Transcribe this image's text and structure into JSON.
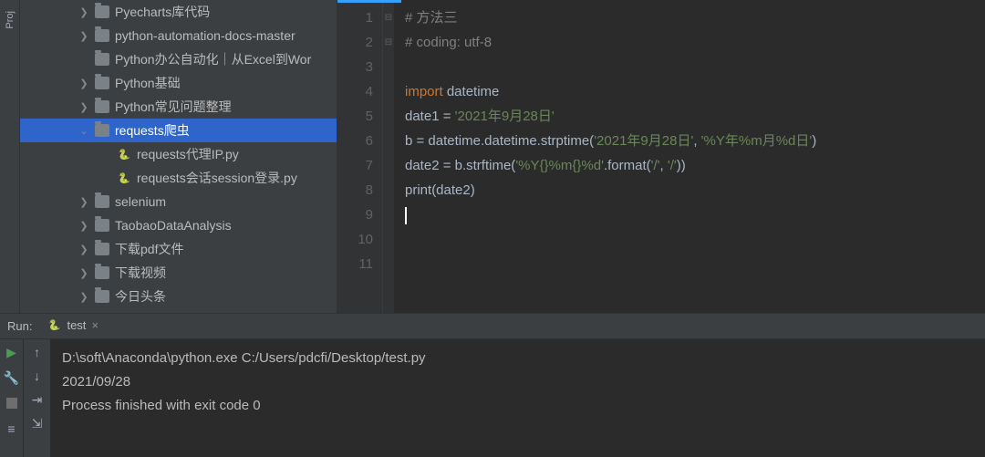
{
  "leftbar": {
    "project_label": "Proj"
  },
  "tree": {
    "items": [
      {
        "type": "dir",
        "level": 0,
        "expand": "right",
        "label": "Pyecharts库代码"
      },
      {
        "type": "dir",
        "level": 0,
        "expand": "right",
        "label": "python-automation-docs-master"
      },
      {
        "type": "dir",
        "level": 0,
        "expand": "none",
        "label": "Python办公自动化｜从Excel到Wor"
      },
      {
        "type": "dir",
        "level": 0,
        "expand": "right",
        "label": "Python基础"
      },
      {
        "type": "dir",
        "level": 0,
        "expand": "right",
        "label": "Python常见问题整理"
      },
      {
        "type": "dir",
        "level": 0,
        "expand": "down",
        "label": "requests爬虫",
        "selected": true
      },
      {
        "type": "py",
        "level": 1,
        "expand": "none",
        "label": "requests代理IP.py"
      },
      {
        "type": "py",
        "level": 1,
        "expand": "none",
        "label": "requests会话session登录.py"
      },
      {
        "type": "dir",
        "level": 0,
        "expand": "right",
        "label": "selenium"
      },
      {
        "type": "dir",
        "level": 0,
        "expand": "right",
        "label": "TaobaoDataAnalysis"
      },
      {
        "type": "dir",
        "level": 0,
        "expand": "right",
        "label": "下载pdf文件"
      },
      {
        "type": "dir",
        "level": 0,
        "expand": "right",
        "label": "下载视频"
      },
      {
        "type": "dir",
        "level": 0,
        "expand": "right",
        "label": "今日头条"
      }
    ]
  },
  "editor": {
    "lines": [
      "1",
      "2",
      "3",
      "4",
      "5",
      "6",
      "7",
      "8",
      "9",
      "10",
      "11"
    ],
    "fold_marks": {
      "0": "⊟",
      "1": "⊟"
    },
    "code": {
      "l1_comment": "# 方法三",
      "l2_comment": "# coding: utf-8",
      "l4_kw": "import ",
      "l4_mod": "datetime",
      "l5_a": "date1 = ",
      "l5_s": "'2021年9月28日'",
      "l6_a": "b = datetime.datetime.strptime(",
      "l6_s1": "'2021年9月28日'",
      "l6_c": ", ",
      "l6_s2": "'%Y年%m月%d日'",
      "l6_e": ")",
      "l7_a": "date2 = b.strftime(",
      "l7_s1": "'%Y{}%m{}%d'",
      "l7_b": ".format(",
      "l7_s2": "'/'",
      "l7_c": ", ",
      "l7_s3": "'/'",
      "l7_e": "))",
      "l8_fn": "print",
      "l8_a": "(date2)"
    }
  },
  "run": {
    "label": "Run:",
    "tab": "test",
    "output": {
      "cmd": "D:\\soft\\Anaconda\\python.exe C:/Users/pdcfi/Desktop/test.py",
      "result": "2021/09/28",
      "blank": " ",
      "exit": "Process finished with exit code 0"
    }
  }
}
